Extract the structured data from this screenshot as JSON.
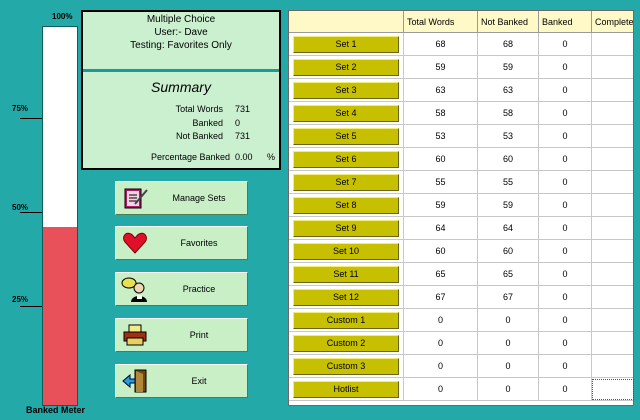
{
  "meter": {
    "labels": {
      "p100": "100%",
      "p75": "75%",
      "p50": "50%",
      "p25": "25%"
    },
    "caption": "Banked Meter",
    "fill_fraction": 0.47,
    "fill_color": "#e8505a"
  },
  "info": {
    "mode": "Multiple Choice",
    "user": "User:- Dave",
    "testing": "Testing: Favorites Only",
    "summary_title": "Summary",
    "stats": [
      {
        "label": "Total Words",
        "value": "731"
      },
      {
        "label": "Banked",
        "value": "0"
      },
      {
        "label": "Not Banked",
        "value": "731"
      }
    ],
    "pct_label": "Percentage Banked",
    "pct_value": "0.00",
    "pct_unit": "%"
  },
  "actions": [
    {
      "name": "manage-sets-button",
      "icon": "notebook-pencil-icon",
      "label": "Manage Sets"
    },
    {
      "name": "favorites-button",
      "icon": "heart-icon",
      "label": "Favorites"
    },
    {
      "name": "practice-button",
      "icon": "person-speech-icon",
      "label": "Practice"
    },
    {
      "name": "print-button",
      "icon": "printer-icon",
      "label": "Print"
    },
    {
      "name": "exit-button",
      "icon": "exit-door-icon",
      "label": "Exit"
    }
  ],
  "table": {
    "headers": [
      "",
      "Total Words",
      "Not Banked",
      "Banked",
      "Complete"
    ],
    "rows": [
      {
        "set": "Set 1",
        "total": "68",
        "not_banked": "68",
        "banked": "0",
        "complete": ""
      },
      {
        "set": "Set 2",
        "total": "59",
        "not_banked": "59",
        "banked": "0",
        "complete": ""
      },
      {
        "set": "Set 3",
        "total": "63",
        "not_banked": "63",
        "banked": "0",
        "complete": ""
      },
      {
        "set": "Set 4",
        "total": "58",
        "not_banked": "58",
        "banked": "0",
        "complete": ""
      },
      {
        "set": "Set 5",
        "total": "53",
        "not_banked": "53",
        "banked": "0",
        "complete": ""
      },
      {
        "set": "Set 6",
        "total": "60",
        "not_banked": "60",
        "banked": "0",
        "complete": ""
      },
      {
        "set": "Set 7",
        "total": "55",
        "not_banked": "55",
        "banked": "0",
        "complete": ""
      },
      {
        "set": "Set 8",
        "total": "59",
        "not_banked": "59",
        "banked": "0",
        "complete": ""
      },
      {
        "set": "Set 9",
        "total": "64",
        "not_banked": "64",
        "banked": "0",
        "complete": ""
      },
      {
        "set": "Set 10",
        "total": "60",
        "not_banked": "60",
        "banked": "0",
        "complete": ""
      },
      {
        "set": "Set 11",
        "total": "65",
        "not_banked": "65",
        "banked": "0",
        "complete": ""
      },
      {
        "set": "Set 12",
        "total": "67",
        "not_banked": "67",
        "banked": "0",
        "complete": ""
      },
      {
        "set": "Custom 1",
        "total": "0",
        "not_banked": "0",
        "banked": "0",
        "complete": ""
      },
      {
        "set": "Custom 2",
        "total": "0",
        "not_banked": "0",
        "banked": "0",
        "complete": ""
      },
      {
        "set": "Custom 3",
        "total": "0",
        "not_banked": "0",
        "banked": "0",
        "complete": ""
      },
      {
        "set": "Hotlist",
        "total": "0",
        "not_banked": "0",
        "banked": "0",
        "complete": ""
      }
    ]
  },
  "colors": {
    "background": "#23aaa8",
    "panel": "#cbf0cf",
    "set_button": "#c7c000",
    "header": "#fff9c8"
  }
}
